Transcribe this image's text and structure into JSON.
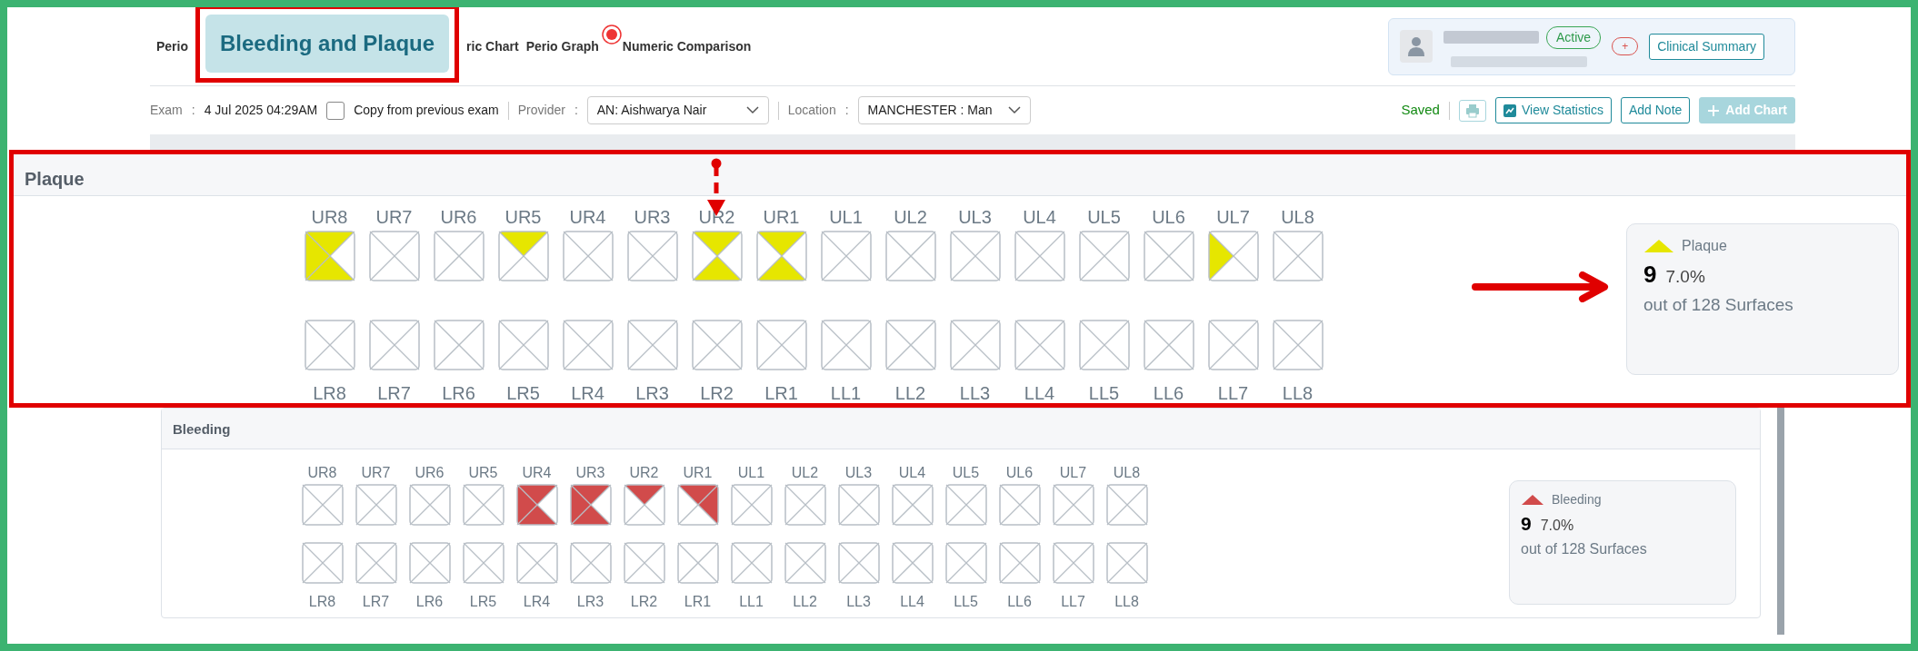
{
  "tabs": [
    {
      "label": "Perio",
      "selected": false,
      "kind": "tab"
    },
    {
      "label": "Bleeding and Plaque",
      "selected": true,
      "kind": "callout"
    },
    {
      "label": "ric Chart",
      "selected": false,
      "kind": "tab"
    },
    {
      "label": "Perio Graph",
      "selected": false,
      "kind": "tab"
    },
    {
      "label": "Numeric Comparison",
      "selected": false,
      "kind": "tab"
    }
  ],
  "patient": {
    "status": "Active",
    "add_label": "+",
    "summary_button": "Clinical Summary"
  },
  "toolbar": {
    "exam": {
      "label": "Exam",
      "colon": ":",
      "value": "4 Jul 2025 04:29AM"
    },
    "copy": {
      "label": "Copy from previous exam",
      "checked": false
    },
    "provider": {
      "label": "Provider",
      "colon": ":",
      "value": "AN: Aishwarya Nair"
    },
    "location": {
      "label": "Location",
      "colon": ":",
      "value": "MANCHESTER : Man"
    },
    "save_status": "Saved",
    "buttons": [
      {
        "label": "View Statistics",
        "kind": "stats",
        "disabled": false
      },
      {
        "label": "Add Note",
        "kind": "plain",
        "disabled": false
      },
      {
        "label": "Add Chart",
        "kind": "add",
        "disabled": true
      }
    ]
  },
  "sections": [
    {
      "title": "Plaque",
      "kind": "callout",
      "color": "#e6e600",
      "upper": [
        {
          "label": "UR8",
          "top": true,
          "right": false,
          "bottom": true,
          "left": true
        },
        {
          "label": "UR7",
          "top": false,
          "right": false,
          "bottom": false,
          "left": false
        },
        {
          "label": "UR6",
          "top": false,
          "right": false,
          "bottom": false,
          "left": false
        },
        {
          "label": "UR5",
          "top": true,
          "right": false,
          "bottom": false,
          "left": false
        },
        {
          "label": "UR4",
          "top": false,
          "right": false,
          "bottom": false,
          "left": false
        },
        {
          "label": "UR3",
          "top": false,
          "right": false,
          "bottom": false,
          "left": false
        },
        {
          "label": "UR2",
          "top": true,
          "right": false,
          "bottom": true,
          "left": false
        },
        {
          "label": "UR1",
          "top": true,
          "right": false,
          "bottom": true,
          "left": false
        },
        {
          "label": "UL1",
          "top": false,
          "right": false,
          "bottom": false,
          "left": false
        },
        {
          "label": "UL2",
          "top": false,
          "right": false,
          "bottom": false,
          "left": false
        },
        {
          "label": "UL3",
          "top": false,
          "right": false,
          "bottom": false,
          "left": false
        },
        {
          "label": "UL4",
          "top": false,
          "right": false,
          "bottom": false,
          "left": false
        },
        {
          "label": "UL5",
          "top": false,
          "right": false,
          "bottom": false,
          "left": false
        },
        {
          "label": "UL6",
          "top": false,
          "right": false,
          "bottom": false,
          "left": false
        },
        {
          "label": "UL7",
          "top": false,
          "right": false,
          "bottom": false,
          "left": true
        },
        {
          "label": "UL8",
          "top": false,
          "right": false,
          "bottom": false,
          "left": false
        }
      ],
      "lower": [
        {
          "label": "LR8",
          "top": false,
          "right": false,
          "bottom": false,
          "left": false
        },
        {
          "label": "LR7",
          "top": false,
          "right": false,
          "bottom": false,
          "left": false
        },
        {
          "label": "LR6",
          "top": false,
          "right": false,
          "bottom": false,
          "left": false
        },
        {
          "label": "LR5",
          "top": false,
          "right": false,
          "bottom": false,
          "left": false
        },
        {
          "label": "LR4",
          "top": false,
          "right": false,
          "bottom": false,
          "left": false
        },
        {
          "label": "LR3",
          "top": false,
          "right": false,
          "bottom": false,
          "left": false
        },
        {
          "label": "LR2",
          "top": false,
          "right": false,
          "bottom": false,
          "left": false
        },
        {
          "label": "LR1",
          "top": false,
          "right": false,
          "bottom": false,
          "left": false
        },
        {
          "label": "LL1",
          "top": false,
          "right": false,
          "bottom": false,
          "left": false
        },
        {
          "label": "LL2",
          "top": false,
          "right": false,
          "bottom": false,
          "left": false
        },
        {
          "label": "LL3",
          "top": false,
          "right": false,
          "bottom": false,
          "left": false
        },
        {
          "label": "LL4",
          "top": false,
          "right": false,
          "bottom": false,
          "left": false
        },
        {
          "label": "LL5",
          "top": false,
          "right": false,
          "bottom": false,
          "left": false
        },
        {
          "label": "LL6",
          "top": false,
          "right": false,
          "bottom": false,
          "left": false
        },
        {
          "label": "LL7",
          "top": false,
          "right": false,
          "bottom": false,
          "left": false
        },
        {
          "label": "LL8",
          "top": false,
          "right": false,
          "bottom": false,
          "left": false
        }
      ],
      "summary": {
        "label": "Plaque",
        "count": "9",
        "percent": "7.0%",
        "caption": "out of 128 Surfaces"
      }
    },
    {
      "title": "Bleeding",
      "kind": "plain",
      "color": "#d14b4b",
      "upper": [
        {
          "label": "UR8",
          "top": false,
          "right": false,
          "bottom": false,
          "left": false
        },
        {
          "label": "UR7",
          "top": false,
          "right": false,
          "bottom": false,
          "left": false
        },
        {
          "label": "UR6",
          "top": false,
          "right": false,
          "bottom": false,
          "left": false
        },
        {
          "label": "UR5",
          "top": false,
          "right": false,
          "bottom": false,
          "left": false
        },
        {
          "label": "UR4",
          "top": true,
          "right": false,
          "bottom": true,
          "left": true
        },
        {
          "label": "UR3",
          "top": true,
          "right": false,
          "bottom": true,
          "left": true
        },
        {
          "label": "UR2",
          "top": true,
          "right": false,
          "bottom": false,
          "left": false
        },
        {
          "label": "UR1",
          "top": true,
          "right": true,
          "bottom": false,
          "left": false
        },
        {
          "label": "UL1",
          "top": false,
          "right": false,
          "bottom": false,
          "left": false
        },
        {
          "label": "UL2",
          "top": false,
          "right": false,
          "bottom": false,
          "left": false
        },
        {
          "label": "UL3",
          "top": false,
          "right": false,
          "bottom": false,
          "left": false
        },
        {
          "label": "UL4",
          "top": false,
          "right": false,
          "bottom": false,
          "left": false
        },
        {
          "label": "UL5",
          "top": false,
          "right": false,
          "bottom": false,
          "left": false
        },
        {
          "label": "UL6",
          "top": false,
          "right": false,
          "bottom": false,
          "left": false
        },
        {
          "label": "UL7",
          "top": false,
          "right": false,
          "bottom": false,
          "left": false
        },
        {
          "label": "UL8",
          "top": false,
          "right": false,
          "bottom": false,
          "left": false
        }
      ],
      "lower": [
        {
          "label": "LR8",
          "top": false,
          "right": false,
          "bottom": false,
          "left": false
        },
        {
          "label": "LR7",
          "top": false,
          "right": false,
          "bottom": false,
          "left": false
        },
        {
          "label": "LR6",
          "top": false,
          "right": false,
          "bottom": false,
          "left": false
        },
        {
          "label": "LR5",
          "top": false,
          "right": false,
          "bottom": false,
          "left": false
        },
        {
          "label": "LR4",
          "top": false,
          "right": false,
          "bottom": false,
          "left": false
        },
        {
          "label": "LR3",
          "top": false,
          "right": false,
          "bottom": false,
          "left": false
        },
        {
          "label": "LR2",
          "top": false,
          "right": false,
          "bottom": false,
          "left": false
        },
        {
          "label": "LR1",
          "top": false,
          "right": false,
          "bottom": false,
          "left": false
        },
        {
          "label": "LL1",
          "top": false,
          "right": false,
          "bottom": false,
          "left": false
        },
        {
          "label": "LL2",
          "top": false,
          "right": false,
          "bottom": false,
          "left": false
        },
        {
          "label": "LL3",
          "top": false,
          "right": false,
          "bottom": false,
          "left": false
        },
        {
          "label": "LL4",
          "top": false,
          "right": false,
          "bottom": false,
          "left": false
        },
        {
          "label": "LL5",
          "top": false,
          "right": false,
          "bottom": false,
          "left": false
        },
        {
          "label": "LL6",
          "top": false,
          "right": false,
          "bottom": false,
          "left": false
        },
        {
          "label": "LL7",
          "top": false,
          "right": false,
          "bottom": false,
          "left": false
        },
        {
          "label": "LL8",
          "top": false,
          "right": false,
          "bottom": false,
          "left": false
        }
      ],
      "summary": {
        "label": "Bleeding",
        "count": "9",
        "percent": "7.0%",
        "caption": "out of 128 Surfaces"
      }
    }
  ]
}
